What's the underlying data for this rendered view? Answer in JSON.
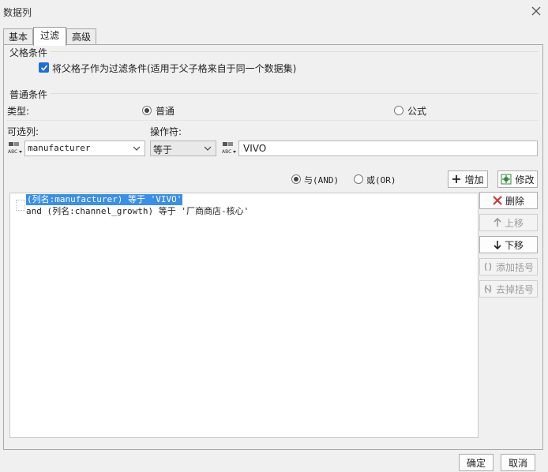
{
  "window": {
    "title": "数据列"
  },
  "tabs": [
    {
      "label": "基本"
    },
    {
      "label": "过滤"
    },
    {
      "label": "高级"
    }
  ],
  "parent_condition": {
    "group_label": "父格条件",
    "checkbox_label": "将父格子作为过滤条件(适用于父子格来自于同一个数据集)",
    "checked": true
  },
  "normal_condition": {
    "group_label": "普通条件",
    "type_label": "类型:",
    "type_options": [
      "普通",
      "公式"
    ],
    "selected_type": "普通",
    "column_label": "可选列:",
    "operator_label": "操作符:",
    "column_value": "manufacturer",
    "operator_value": "等于",
    "value_input": "VIVO"
  },
  "logic": {
    "and_label": "与(AND)",
    "or_label": "或(OR)",
    "selected": "与(AND)"
  },
  "buttons": {
    "add": "增加",
    "modify": "修改",
    "delete": "删除",
    "move_up": "上移",
    "move_down": "下移",
    "add_bracket": "添加括号",
    "remove_bracket": "去掉括号",
    "ok": "确定",
    "cancel": "取消"
  },
  "conditions": [
    {
      "text": "(列名:manufacturer) 等于 'VIVO'",
      "selected": true
    },
    {
      "text": "and (列名:channel_growth) 等于 '厂商商店-核心'",
      "selected": false
    }
  ],
  "colors": {
    "accent": "#1e6fd9",
    "selection": "#3a8fe8",
    "delete_red": "#d62d2d",
    "modify_green": "#2e8b3a"
  }
}
